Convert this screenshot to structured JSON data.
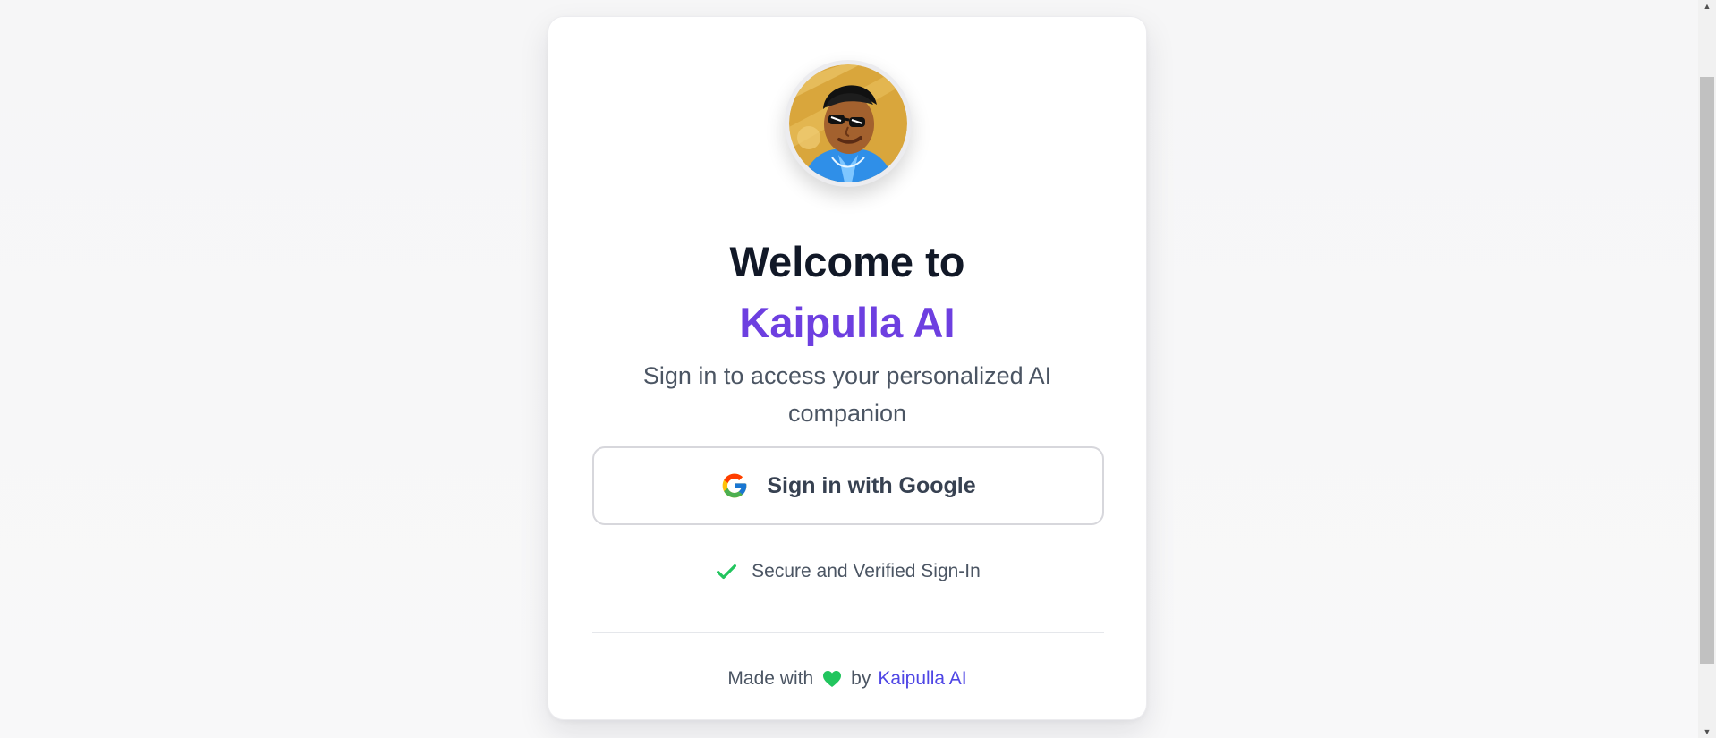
{
  "card": {
    "title_line1": "Welcome to",
    "title_line2": "Kaipulla AI",
    "subtitle": "Sign in to access your personalized AI companion",
    "google_button_label": "Sign in with Google",
    "secure_text": "Secure and Verified Sign-In",
    "footer": {
      "prefix": "Made with",
      "middle": "by",
      "link": "Kaipulla AI"
    }
  },
  "icons": {
    "avatar": "avatar-cartoon",
    "google": "google-icon",
    "check": "check-icon",
    "heart": "heart-icon"
  },
  "colors": {
    "accent_purple": "#6d3fe0",
    "link_indigo": "#4f46e5",
    "check_green": "#22c55e",
    "heart_green": "#22c55e"
  }
}
